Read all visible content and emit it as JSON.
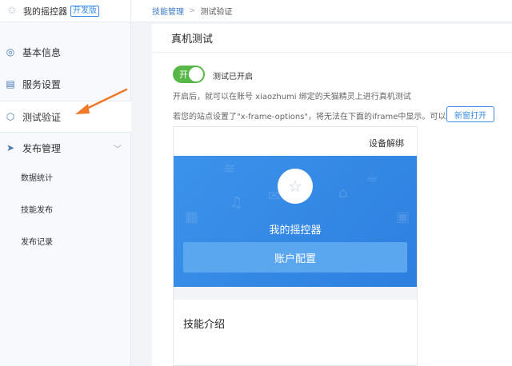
{
  "app": {
    "name": "我的摇控器",
    "badge": "开发版"
  },
  "sidebar": {
    "items": [
      {
        "label": "基本信息",
        "icon": "info-icon"
      },
      {
        "label": "服务设置",
        "icon": "settings-icon"
      },
      {
        "label": "测试验证",
        "icon": "test-icon"
      },
      {
        "label": "发布管理",
        "icon": "send-icon"
      }
    ],
    "subitems": [
      "数据统计",
      "技能发布",
      "发布记录"
    ]
  },
  "breadcrumb": {
    "parent": "技能管理",
    "separator": ">",
    "current": "测试验证"
  },
  "main": {
    "title": "真机测试",
    "toggle_label": "开",
    "toggle_status": "测试已开启",
    "desc1": "开启后，就可以在账号 xiaozhumi 绑定的天猫精灵上进行真机测试",
    "desc2": "若您的站点设置了\"x-frame-options\"，将无法在下面的iframe中显示。可以尝试",
    "newwin_label": "新窗打开"
  },
  "preview": {
    "unbind_label": "设备解绑",
    "skill_name": "我的摇控器",
    "account_button": "账户配置",
    "intro_title": "技能介绍"
  },
  "colors": {
    "accent": "#3a8ee6",
    "toggle_on": "#58b847",
    "hero": "#2d7fe0",
    "arrow": "#f07a2a"
  }
}
